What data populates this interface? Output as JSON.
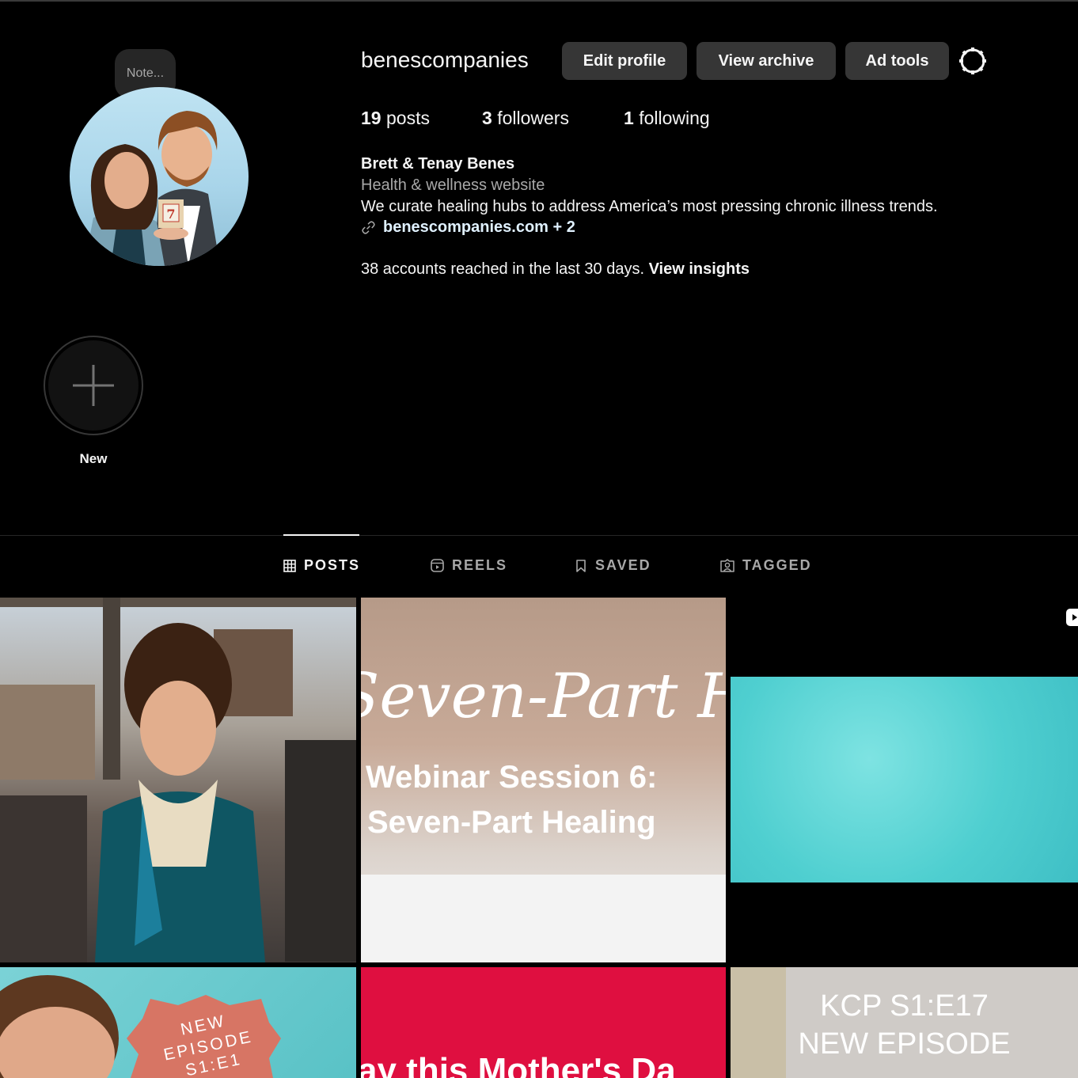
{
  "profile": {
    "username": "benescompanies",
    "note_placeholder": "Note...",
    "buttons": {
      "edit": "Edit profile",
      "archive": "View archive",
      "ad_tools": "Ad tools"
    },
    "stats": {
      "posts_count": "19",
      "posts_label": "posts",
      "followers_count": "3",
      "followers_label": "followers",
      "following_count": "1",
      "following_label": "following"
    },
    "full_name": "Brett & Tenay Benes",
    "category": "Health & wellness website",
    "bio": "We curate healing hubs to address America’s most pressing chronic illness trends.",
    "link": "benescompanies.com + 2",
    "insights_text": "38 accounts reached in the last 30 days.",
    "insights_link": "View insights"
  },
  "highlights": {
    "new_label": "New"
  },
  "tabs": [
    {
      "label": "POSTS",
      "icon": "grid-icon"
    },
    {
      "label": "REELS",
      "icon": "reels-icon"
    },
    {
      "label": "SAVED",
      "icon": "bookmark-icon"
    },
    {
      "label": "TAGGED",
      "icon": "tagged-icon"
    }
  ],
  "posts": {
    "p2_script": "Seven-Part Heale",
    "p2_line1": "Webinar Session 6:",
    "p2_line2": "Seven-Part Healing",
    "p4_badge_line1": "NEW",
    "p4_badge_line2": "EPISODE",
    "p4_badge_line3": "S1:E1",
    "p5_text": "ay this Mother's Da",
    "p6_line1": "KCP S1:E17",
    "p6_line2": "NEW EPISODE"
  },
  "colors": {
    "background": "#000000",
    "button": "#363636",
    "secondary_text": "#a8a8a8",
    "link": "#e0f1ff"
  }
}
